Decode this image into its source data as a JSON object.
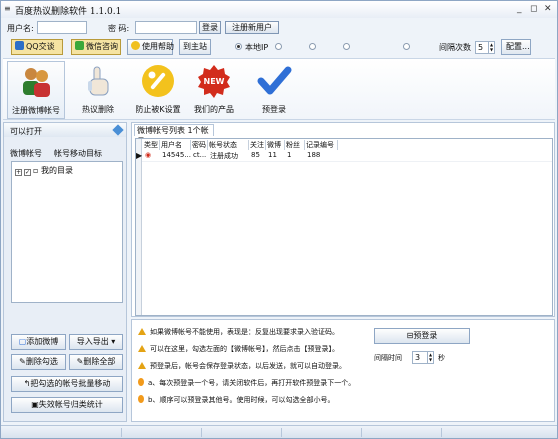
{
  "window": {
    "title": "百度热议删除软件 1.1.0.1"
  },
  "login": {
    "username_label": "用户名:",
    "username_value": "",
    "password_label": "密  码:",
    "password_value": "",
    "login_button": "登录",
    "register_button": "注册新用户"
  },
  "toolbar": {
    "buttons": [
      {
        "label": "QQ交谈"
      },
      {
        "label": "微信咨询"
      },
      {
        "label": "使用帮助"
      },
      {
        "label": "到主站"
      }
    ],
    "radio_local_label": "本地IP",
    "radio_dim": [
      "",
      "",
      "",
      ""
    ],
    "interval_label": "间隔次数",
    "interval_value": "5",
    "config_button": "配置..."
  },
  "ribbon": [
    {
      "label": "注册微博帐号",
      "icon": "users-icon",
      "selected": true
    },
    {
      "label": "热议删除",
      "icon": "hand-pointer-icon"
    },
    {
      "label": "防止被K设置",
      "icon": "wrench-icon"
    },
    {
      "label": "我们的产品",
      "icon": "new-badge-icon"
    },
    {
      "label": "预登录",
      "icon": "checkmark-icon"
    }
  ],
  "left_panel": {
    "header": "可以打开",
    "tabs": [
      "微博帐号",
      "帐号移动目标"
    ],
    "tree_node": "我的目录",
    "buttons": {
      "add": "添加微博",
      "import_export": "导入导出",
      "delete_checked": "删除勾选",
      "delete_all": "删除全部",
      "batch_move": "把勾选的帐号批量移动",
      "invalid_stats": "失效帐号归类统计"
    }
  },
  "right_panel": {
    "tab": "微博帐号列表 1个帐号",
    "columns": [
      "类型",
      "用户名",
      "密码",
      "帐号状态",
      "关注",
      "微博",
      "粉丝",
      "记录编号"
    ],
    "rows": [
      [
        "",
        "14545...",
        "ct...",
        "注册成功",
        "85",
        "11",
        "1",
        "188"
      ]
    ]
  },
  "tips": {
    "lines": [
      "如果微博帐号不能使用，表现是：反复出现要求录入验证码。",
      "可以在这里，勾选左面的【微博帐号】，然后点击【预登录】。",
      "预登录后，帐号会保存登录状态，以后发送，就可以自动登录。",
      "a、每次预登录一个号，请关闭软件后，再打开软件预登录下一个。",
      "b、顺序可以预登录其他号。使用时候，可以勾选全部小号。"
    ],
    "prelogin_button": "预登录",
    "interval_label": "间隔时间",
    "interval_value": "3",
    "interval_unit": "秒"
  },
  "colors": {
    "accent": "#2f6fd6",
    "warning": "#e4a314",
    "new_badge": "#d22c1c"
  }
}
